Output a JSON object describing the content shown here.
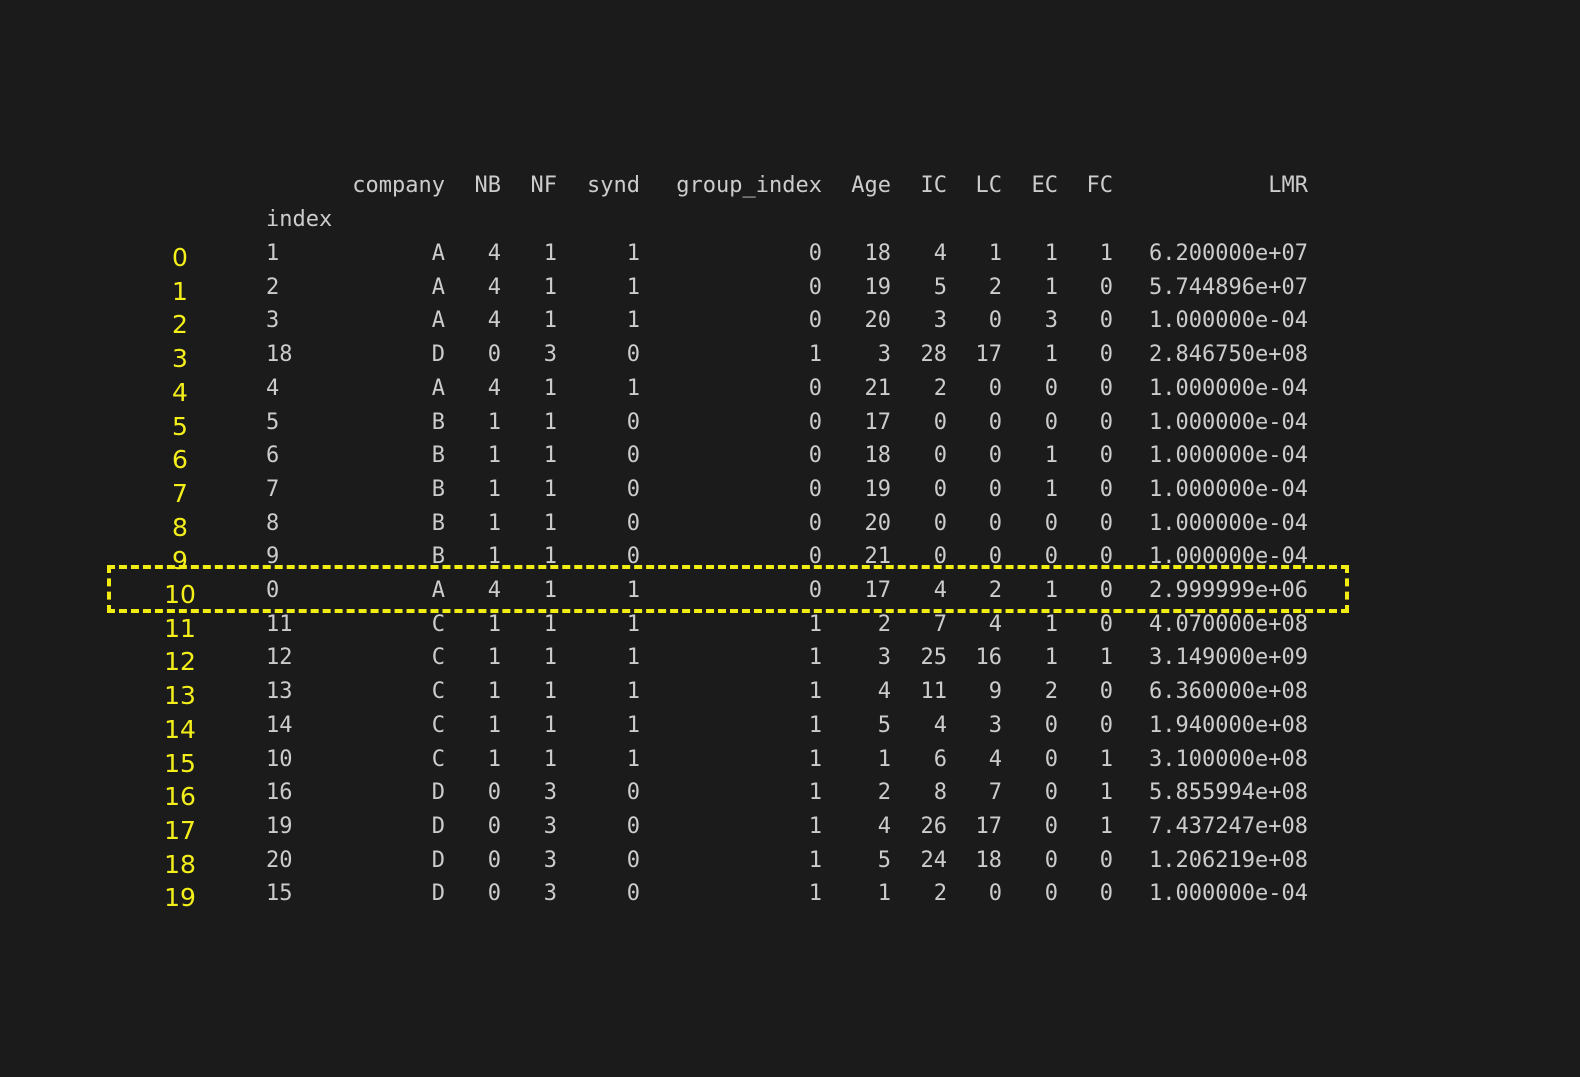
{
  "index_label": "index",
  "columns": [
    "company",
    "NB",
    "NF",
    "synd",
    "group_index",
    "Age",
    "IC",
    "LC",
    "EC",
    "FC",
    "LMR"
  ],
  "rows": [
    {
      "label": "0",
      "values": [
        "1",
        "A",
        "4",
        "1",
        "1",
        "0",
        "18",
        "4",
        "1",
        "1",
        "1",
        "6.200000e+07"
      ]
    },
    {
      "label": "1",
      "values": [
        "2",
        "A",
        "4",
        "1",
        "1",
        "0",
        "19",
        "5",
        "2",
        "1",
        "0",
        "5.744896e+07"
      ]
    },
    {
      "label": "2",
      "values": [
        "3",
        "A",
        "4",
        "1",
        "1",
        "0",
        "20",
        "3",
        "0",
        "3",
        "0",
        "1.000000e-04"
      ]
    },
    {
      "label": "3",
      "values": [
        "18",
        "D",
        "0",
        "3",
        "0",
        "1",
        "3",
        "28",
        "17",
        "1",
        "0",
        "2.846750e+08"
      ]
    },
    {
      "label": "4",
      "values": [
        "4",
        "A",
        "4",
        "1",
        "1",
        "0",
        "21",
        "2",
        "0",
        "0",
        "0",
        "1.000000e-04"
      ]
    },
    {
      "label": "5",
      "values": [
        "5",
        "B",
        "1",
        "1",
        "0",
        "0",
        "17",
        "0",
        "0",
        "0",
        "0",
        "1.000000e-04"
      ]
    },
    {
      "label": "6",
      "values": [
        "6",
        "B",
        "1",
        "1",
        "0",
        "0",
        "18",
        "0",
        "0",
        "1",
        "0",
        "1.000000e-04"
      ]
    },
    {
      "label": "7",
      "values": [
        "7",
        "B",
        "1",
        "1",
        "0",
        "0",
        "19",
        "0",
        "0",
        "1",
        "0",
        "1.000000e-04"
      ]
    },
    {
      "label": "8",
      "values": [
        "8",
        "B",
        "1",
        "1",
        "0",
        "0",
        "20",
        "0",
        "0",
        "0",
        "0",
        "1.000000e-04"
      ]
    },
    {
      "label": "9",
      "values": [
        "9",
        "B",
        "1",
        "1",
        "0",
        "0",
        "21",
        "0",
        "0",
        "0",
        "0",
        "1.000000e-04"
      ]
    },
    {
      "label": "10",
      "values": [
        "0",
        "A",
        "4",
        "1",
        "1",
        "0",
        "17",
        "4",
        "2",
        "1",
        "0",
        "2.999999e+06"
      ]
    },
    {
      "label": "11",
      "values": [
        "11",
        "C",
        "1",
        "1",
        "1",
        "1",
        "2",
        "7",
        "4",
        "1",
        "0",
        "4.070000e+08"
      ]
    },
    {
      "label": "12",
      "values": [
        "12",
        "C",
        "1",
        "1",
        "1",
        "1",
        "3",
        "25",
        "16",
        "1",
        "1",
        "3.149000e+09"
      ]
    },
    {
      "label": "13",
      "values": [
        "13",
        "C",
        "1",
        "1",
        "1",
        "1",
        "4",
        "11",
        "9",
        "2",
        "0",
        "6.360000e+08"
      ]
    },
    {
      "label": "14",
      "values": [
        "14",
        "C",
        "1",
        "1",
        "1",
        "1",
        "5",
        "4",
        "3",
        "0",
        "0",
        "1.940000e+08"
      ]
    },
    {
      "label": "15",
      "values": [
        "10",
        "C",
        "1",
        "1",
        "1",
        "1",
        "1",
        "6",
        "4",
        "0",
        "1",
        "3.100000e+08"
      ]
    },
    {
      "label": "16",
      "values": [
        "16",
        "D",
        "0",
        "3",
        "0",
        "1",
        "2",
        "8",
        "7",
        "0",
        "1",
        "5.855994e+08"
      ]
    },
    {
      "label": "17",
      "values": [
        "19",
        "D",
        "0",
        "3",
        "0",
        "1",
        "4",
        "26",
        "17",
        "0",
        "1",
        "7.437247e+08"
      ]
    },
    {
      "label": "18",
      "values": [
        "20",
        "D",
        "0",
        "3",
        "0",
        "1",
        "5",
        "24",
        "18",
        "0",
        "0",
        "1.206219e+08"
      ]
    },
    {
      "label": "19",
      "values": [
        "15",
        "D",
        "0",
        "3",
        "0",
        "1",
        "1",
        "2",
        "0",
        "0",
        "0",
        "1.000000e-04"
      ]
    }
  ],
  "highlighted_row": "10",
  "colors": {
    "background": "#1b1b1b",
    "text": "#cccccc",
    "annotation": "#f4ef1a",
    "highlight_border": "#f1ec12"
  }
}
